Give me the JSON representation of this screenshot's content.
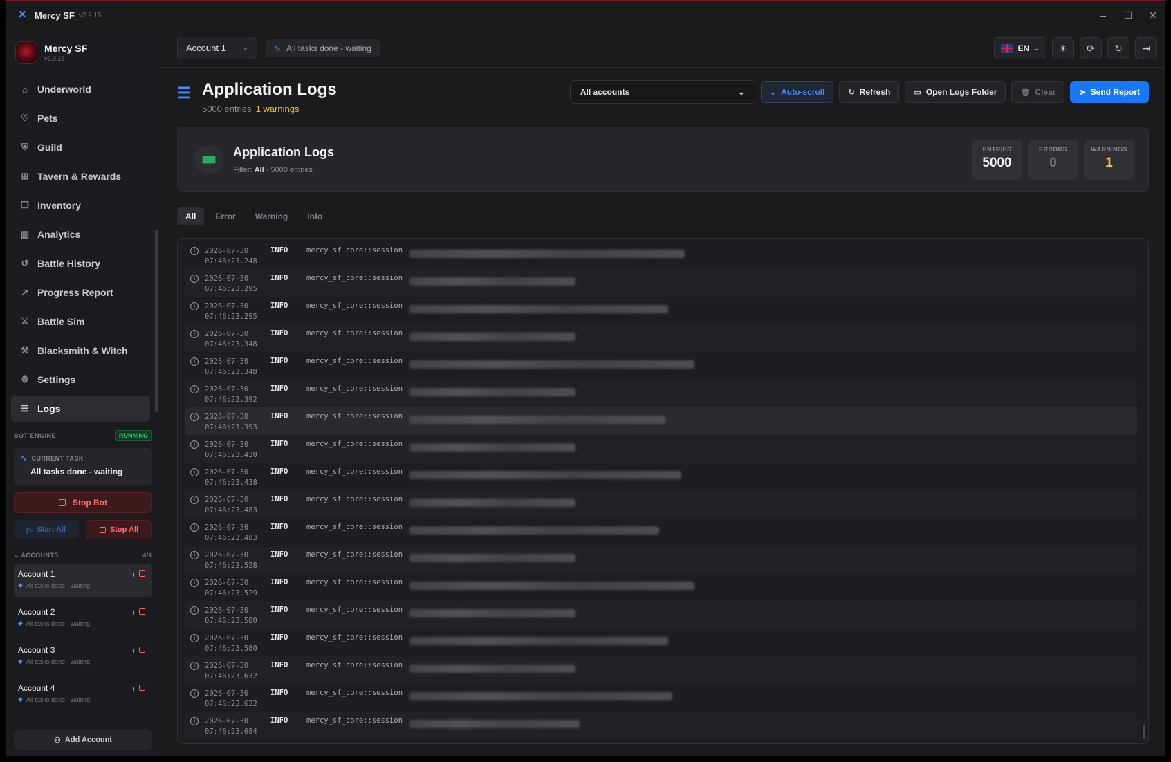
{
  "titlebar": {
    "app_name": "Mercy SF",
    "version": "v2.9.15",
    "logo_icon": "crossed-swords-icon",
    "controls": [
      "minimize-icon",
      "maximize-icon",
      "close-icon"
    ]
  },
  "sidebar": {
    "brand_name": "Mercy SF",
    "brand_version": "v2.9.15",
    "nav": [
      {
        "label": "Underworld",
        "icon": "home-icon",
        "glyph": "⌂"
      },
      {
        "label": "Pets",
        "icon": "pet-icon",
        "glyph": "♡"
      },
      {
        "label": "Guild",
        "icon": "shield-icon",
        "glyph": "⛨"
      },
      {
        "label": "Tavern & Rewards",
        "icon": "gift-icon",
        "glyph": "⊞"
      },
      {
        "label": "Inventory",
        "icon": "box-icon",
        "glyph": "❒"
      },
      {
        "label": "Analytics",
        "icon": "bar-chart-icon",
        "glyph": "▥"
      },
      {
        "label": "Battle History",
        "icon": "history-icon",
        "glyph": "↺"
      },
      {
        "label": "Progress Report",
        "icon": "trending-up-icon",
        "glyph": "↗"
      },
      {
        "label": "Battle Sim",
        "icon": "swords-icon",
        "glyph": "⚔"
      },
      {
        "label": "Blacksmith & Witch",
        "icon": "hammer-icon",
        "glyph": "⚒"
      },
      {
        "label": "Settings",
        "icon": "gear-icon",
        "glyph": "⚙"
      },
      {
        "label": "Logs",
        "icon": "scroll-icon",
        "glyph": "☰"
      }
    ],
    "active_nav": "Logs",
    "bot_engine": {
      "label": "BOT ENGINE",
      "status": "RUNNING",
      "current_task_label": "CURRENT TASK",
      "current_task_value": "All tasks done - waiting",
      "stop_bot_label": "Stop Bot",
      "start_all_label": "Start All",
      "stop_all_label": "Stop All"
    },
    "accounts_header": "ACCOUNTS",
    "accounts_count": "4/4",
    "accounts": [
      {
        "name": "Account 1",
        "status": "All tasks done - waiting",
        "active": true
      },
      {
        "name": "Account 2",
        "status": "All tasks done - waiting",
        "active": false
      },
      {
        "name": "Account 3",
        "status": "All tasks done - waiting",
        "active": false
      },
      {
        "name": "Account 4",
        "status": "All tasks done - waiting",
        "active": false
      }
    ],
    "add_account_label": "Add Account"
  },
  "topbar": {
    "account_selected": "Account 1",
    "task_status": "All tasks done - waiting",
    "language": "EN",
    "icons": [
      "sun-icon",
      "sync-icon",
      "refresh-icon",
      "logout-icon"
    ]
  },
  "page": {
    "title": "Application Logs",
    "entries_text": "5000 entries",
    "warnings_text": "1 warnings"
  },
  "toolbar": {
    "filter_value": "All accounts",
    "auto_scroll_label": "Auto-scroll",
    "refresh_label": "Refresh",
    "open_folder_label": "Open Logs Folder",
    "clear_label": "Clear",
    "send_report_label": "Send Report"
  },
  "summary": {
    "title": "Application Logs",
    "filter_label": "Filter:",
    "filter_value": "All",
    "filter_suffix": "· 5000 entries",
    "stats": [
      {
        "label": "ENTRIES",
        "value": "5000"
      },
      {
        "label": "ERRORS",
        "value": "0"
      },
      {
        "label": "WARNINGS",
        "value": "1"
      }
    ]
  },
  "tabs": [
    "All",
    "Error",
    "Warning",
    "Info"
  ],
  "active_tab": "All",
  "logs": [
    {
      "date": "2026-07-30",
      "time": "07:46:23.248",
      "level": "INFO",
      "source": "mercy_sf_core::session"
    },
    {
      "date": "2026-07-30",
      "time": "07:46:23.295",
      "level": "INFO",
      "source": "mercy_sf_core::session"
    },
    {
      "date": "2026-07-30",
      "time": "07:46:23.295",
      "level": "INFO",
      "source": "mercy_sf_core::session"
    },
    {
      "date": "2026-07-30",
      "time": "07:46:23.348",
      "level": "INFO",
      "source": "mercy_sf_core::session"
    },
    {
      "date": "2026-07-30",
      "time": "07:46:23.348",
      "level": "INFO",
      "source": "mercy_sf_core::session"
    },
    {
      "date": "2026-07-30",
      "time": "07:46:23.392",
      "level": "INFO",
      "source": "mercy_sf_core::session"
    },
    {
      "date": "2026-07-30",
      "time": "07:46:23.393",
      "level": "INFO",
      "source": "mercy_sf_core::session"
    },
    {
      "date": "2026-07-30",
      "time": "07:46:23.438",
      "level": "INFO",
      "source": "mercy_sf_core::session"
    },
    {
      "date": "2026-07-30",
      "time": "07:46:23.438",
      "level": "INFO",
      "source": "mercy_sf_core::session"
    },
    {
      "date": "2026-07-30",
      "time": "07:46:23.483",
      "level": "INFO",
      "source": "mercy_sf_core::session"
    },
    {
      "date": "2026-07-30",
      "time": "07:46:23.483",
      "level": "INFO",
      "source": "mercy_sf_core::session"
    },
    {
      "date": "2026-07-30",
      "time": "07:46:23.528",
      "level": "INFO",
      "source": "mercy_sf_core::session"
    },
    {
      "date": "2026-07-30",
      "time": "07:46:23.529",
      "level": "INFO",
      "source": "mercy_sf_core::session"
    },
    {
      "date": "2026-07-30",
      "time": "07:46:23.580",
      "level": "INFO",
      "source": "mercy_sf_core::session"
    },
    {
      "date": "2026-07-30",
      "time": "07:46:23.580",
      "level": "INFO",
      "source": "mercy_sf_core::session"
    },
    {
      "date": "2026-07-30",
      "time": "07:46:23.632",
      "level": "INFO",
      "source": "mercy_sf_core::session"
    },
    {
      "date": "2026-07-30",
      "time": "07:46:23.632",
      "level": "INFO",
      "source": "mercy_sf_core::session"
    },
    {
      "date": "2026-07-30",
      "time": "07:46:23.684",
      "level": "INFO",
      "source": "mercy_sf_core::session"
    }
  ],
  "colors": {
    "accent": "#1877f2",
    "running": "#39d26d",
    "warning": "#f5c518",
    "danger": "#ff6b72"
  }
}
